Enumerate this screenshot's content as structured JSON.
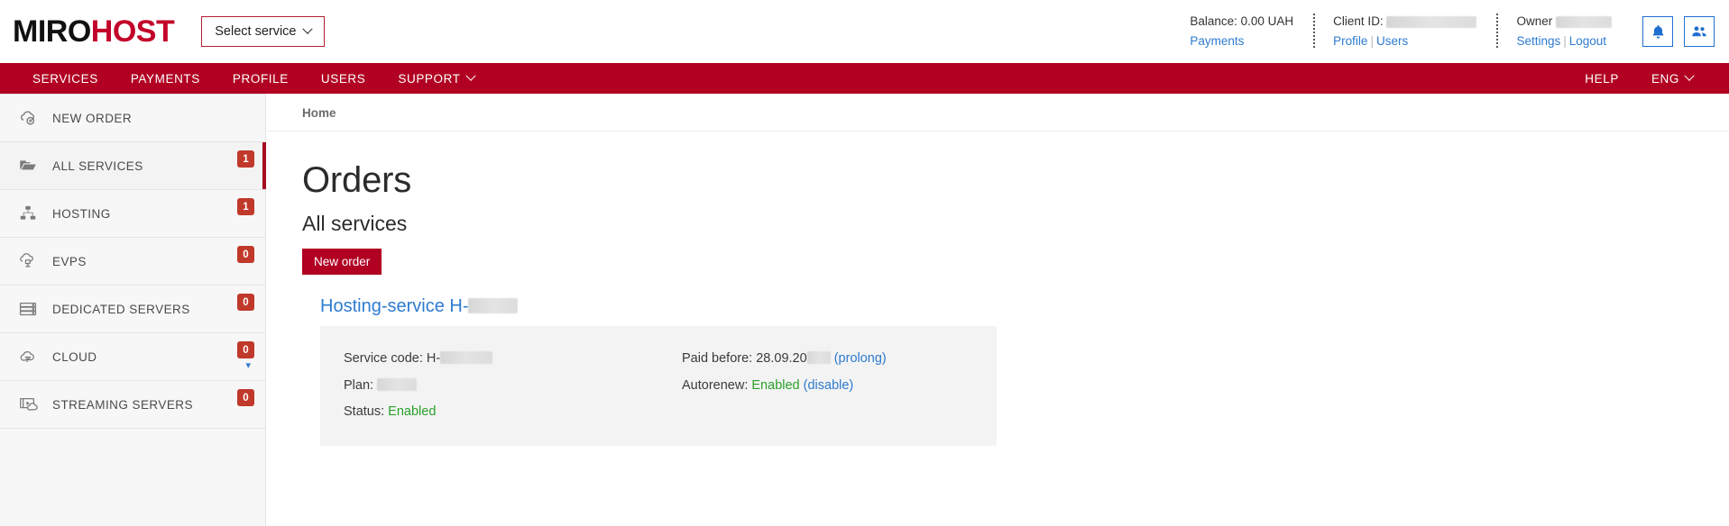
{
  "brand": {
    "name_part1": "MIRO",
    "name_part2": "HOST",
    "color_dark": "#111111",
    "color_red": "#c20029"
  },
  "header": {
    "select_service_label": "Select service",
    "balance": {
      "label": "Balance: 0.00 UAH",
      "link": "Payments"
    },
    "client": {
      "label": "Client ID:",
      "value_redacted": true,
      "link_profile": "Profile",
      "separator": "|",
      "link_users": "Users"
    },
    "owner": {
      "label": "Owner",
      "value_redacted": true,
      "link_settings": "Settings",
      "separator": "|",
      "link_logout": "Logout"
    },
    "icons": {
      "bell": "bell-icon",
      "users": "users-icon"
    }
  },
  "nav": {
    "accent_color": "#b10022",
    "items": [
      {
        "label": "SERVICES",
        "has_caret": false
      },
      {
        "label": "PAYMENTS",
        "has_caret": false
      },
      {
        "label": "PROFILE",
        "has_caret": false
      },
      {
        "label": "USERS",
        "has_caret": false
      },
      {
        "label": "SUPPORT",
        "has_caret": true
      }
    ],
    "right": [
      {
        "label": "HELP",
        "has_caret": false
      },
      {
        "label": "ENG",
        "has_caret": true
      }
    ]
  },
  "sidebar": {
    "items": [
      {
        "label": "NEW ORDER",
        "icon": "cloud-plus-icon",
        "badge": null,
        "active": false,
        "caret": false
      },
      {
        "label": "ALL SERVICES",
        "icon": "folder-icon",
        "badge": "1",
        "active": true,
        "caret": false
      },
      {
        "label": "HOSTING",
        "icon": "network-icon",
        "badge": "1",
        "active": false,
        "caret": false
      },
      {
        "label": "EVPS",
        "icon": "cloud-server-icon",
        "badge": "0",
        "active": false,
        "caret": false
      },
      {
        "label": "DEDICATED SERVERS",
        "icon": "server-stack-icon",
        "badge": "0",
        "active": false,
        "caret": false
      },
      {
        "label": "CLOUD",
        "icon": "cloud-icon",
        "badge": "0",
        "active": false,
        "caret": true
      },
      {
        "label": "STREAMING SERVERS",
        "icon": "streaming-icon",
        "badge": "0",
        "active": false,
        "caret": false
      }
    ]
  },
  "main": {
    "breadcrumb": "Home",
    "page_title": "Orders",
    "section_title": "All services",
    "new_order_button": "New order",
    "service": {
      "link_prefix": "Hosting-service H-",
      "left": {
        "service_code_label": "Service code: H-",
        "plan_label": "Plan:",
        "status_label": "Status:",
        "status_value": "Enabled"
      },
      "right": {
        "paid_before_label": "Paid before:",
        "paid_before_value": "28.09.20",
        "prolong_link": "(prolong)",
        "autorenew_label": "Autorenew:",
        "autorenew_value": "Enabled",
        "disable_link": "(disable)"
      }
    }
  },
  "colors": {
    "status_ok": "#2aa02a",
    "link": "#2e7bd0",
    "badge": "#c0392b",
    "active_bar": "#a30d22"
  }
}
